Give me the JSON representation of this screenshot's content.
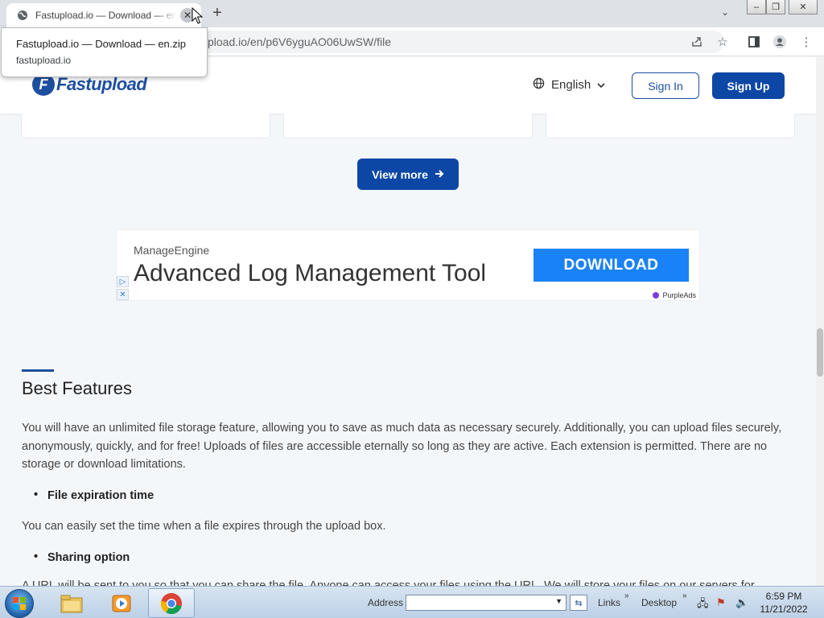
{
  "browser": {
    "tab_title": "Fastupload.io — Download — en.zip",
    "tooltip_title": "Fastupload.io — Download — en.zip",
    "tooltip_domain": "fastupload.io",
    "url_visible": "pload.io/en/p6V6yguAO06UwSW/file"
  },
  "site": {
    "logo_letter": "F",
    "logo_text": "Fastupload",
    "language": "English",
    "sign_in": "Sign In",
    "sign_up": "Sign Up",
    "view_more": "View more"
  },
  "ad": {
    "brand": "ManageEngine",
    "headline": "Advanced Log Management Tool",
    "cta": "DOWNLOAD",
    "network": "PurpleAds"
  },
  "features": {
    "heading": "Best Features",
    "intro": "You will have an unlimited file storage feature, allowing you to save as much data as necessary securely. Additionally, you can upload files securely, anonymously, quickly, and for free! Uploads of files are accessible eternally so long as they are active. Each extension is permitted. There are no storage or download limitations.",
    "bullet1": "File expiration time",
    "bullet1_text": "You can easily set the time when a file expires through the upload box.",
    "bullet2": "Sharing option",
    "bullet2_text": "A URL will be sent to you so that you can share the file. Anyone can access your files using the URL. We will store your files on our servers for"
  },
  "taskbar": {
    "address_label": "Address",
    "links_label": "Links",
    "desktop_label": "Desktop",
    "time": "6:59 PM",
    "date": "11/21/2022"
  },
  "colors": {
    "brand_blue": "#0c47a5",
    "ad_blue": "#1a82f7"
  }
}
